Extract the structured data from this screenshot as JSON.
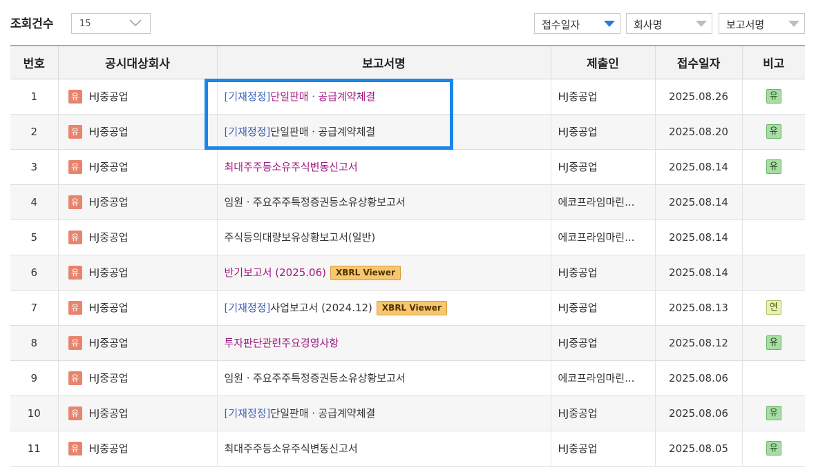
{
  "toolbar": {
    "count_label": "조회건수",
    "count_value": "15",
    "sort_date": "접수일자",
    "sort_company": "회사명",
    "sort_report": "보고서명"
  },
  "columns": [
    "번호",
    "공시대상회사",
    "보고서명",
    "제출인",
    "접수일자",
    "비고"
  ],
  "accent_colors": {
    "highlight": "#1a86e8",
    "sort_active": "#2a7ad6",
    "amend_text": "#3f62b8",
    "purple_text": "#a0187f"
  },
  "rows": [
    {
      "num": "1",
      "market": "유",
      "company": "HJ중공업",
      "prefix": "[기재정정]",
      "title": "단일판매ㆍ공급계약체결",
      "xbrl": "",
      "filer": "HJ중공업",
      "date": "2025.08.26",
      "note": "유"
    },
    {
      "num": "2",
      "market": "유",
      "company": "HJ중공업",
      "prefix": "[기재정정]",
      "title": "단일판매ㆍ공급계약체결",
      "xbrl": "",
      "filer": "HJ중공업",
      "date": "2025.08.20",
      "note": "유"
    },
    {
      "num": "3",
      "market": "유",
      "company": "HJ중공업",
      "prefix": "",
      "title": "최대주주등소유주식변동신고서",
      "xbrl": "",
      "filer": "HJ중공업",
      "date": "2025.08.14",
      "note": "유"
    },
    {
      "num": "4",
      "market": "유",
      "company": "HJ중공업",
      "prefix": "",
      "title": "임원ㆍ주요주주특정증권등소유상황보고서",
      "xbrl": "",
      "filer": "에코프라임마린...",
      "date": "2025.08.14",
      "note": ""
    },
    {
      "num": "5",
      "market": "유",
      "company": "HJ중공업",
      "prefix": "",
      "title": "주식등의대량보유상황보고서(일반)",
      "xbrl": "",
      "filer": "에코프라임마린...",
      "date": "2025.08.14",
      "note": ""
    },
    {
      "num": "6",
      "market": "유",
      "company": "HJ중공업",
      "prefix": "",
      "title": "반기보고서 (2025.06)",
      "xbrl": "XBRL Viewer",
      "filer": "HJ중공업",
      "date": "2025.08.14",
      "note": ""
    },
    {
      "num": "7",
      "market": "유",
      "company": "HJ중공업",
      "prefix": "[기재정정]",
      "title": "사업보고서 (2024.12)",
      "xbrl": "XBRL Viewer",
      "filer": "HJ중공업",
      "date": "2025.08.13",
      "note": "연"
    },
    {
      "num": "8",
      "market": "유",
      "company": "HJ중공업",
      "prefix": "",
      "title": "투자판단관련주요경영사항",
      "xbrl": "",
      "filer": "HJ중공업",
      "date": "2025.08.12",
      "note": "유"
    },
    {
      "num": "9",
      "market": "유",
      "company": "HJ중공업",
      "prefix": "",
      "title": "임원ㆍ주요주주특정증권등소유상황보고서",
      "xbrl": "",
      "filer": "에코프라임마린...",
      "date": "2025.08.06",
      "note": ""
    },
    {
      "num": "10",
      "market": "유",
      "company": "HJ중공업",
      "prefix": "[기재정정]",
      "title": "단일판매ㆍ공급계약체결",
      "xbrl": "",
      "filer": "HJ중공업",
      "date": "2025.08.06",
      "note": "유"
    },
    {
      "num": "11",
      "market": "유",
      "company": "HJ중공업",
      "prefix": "",
      "title": "최대주주등소유주식변동신고서",
      "xbrl": "",
      "filer": "HJ중공업",
      "date": "2025.08.05",
      "note": "유"
    }
  ]
}
